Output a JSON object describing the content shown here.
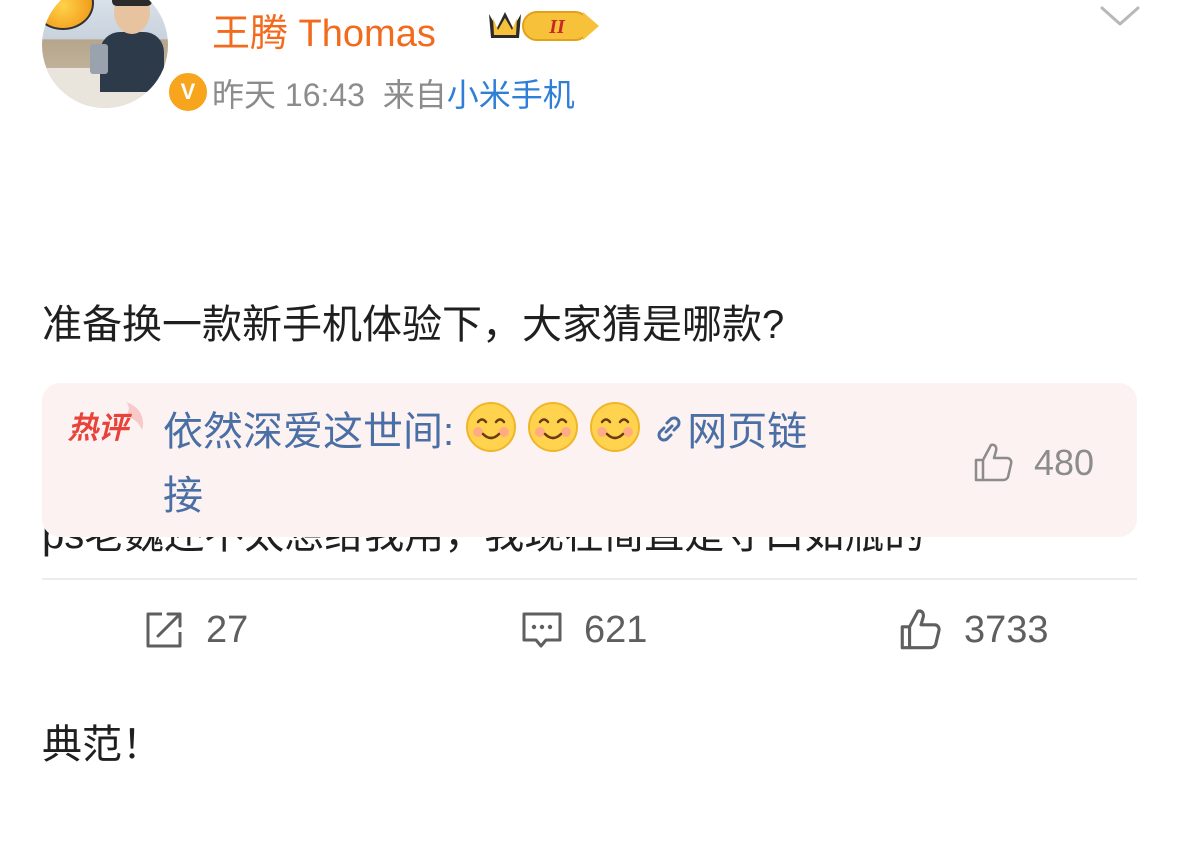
{
  "author": {
    "name": "王腾 Thomas",
    "level_badge": "II",
    "verified_badge": "V",
    "name_color": "#f26b1d"
  },
  "meta": {
    "time": "昨天 16:43",
    "from_label": "来自",
    "source": "小米手机"
  },
  "post": {
    "lines": [
      "准备换一款新手机体验下，大家猜是哪款?",
      "ps老魏还不太想给我用，我现在简直是守口如瓶的",
      "典范！"
    ]
  },
  "hot_comment": {
    "tag": "热评",
    "user": "依然深爱这世间:",
    "emojis": [
      "smile-emoji",
      "smile-emoji",
      "smile-emoji"
    ],
    "link_text": "网页链",
    "link_text_wrap": "接",
    "likes": "480"
  },
  "actions": {
    "repost": "27",
    "comment": "621",
    "like": "3733"
  },
  "icons": [
    "chevron-down-icon",
    "crown-icon",
    "link-icon",
    "thumbs-up-icon",
    "repost-icon",
    "comment-icon"
  ]
}
